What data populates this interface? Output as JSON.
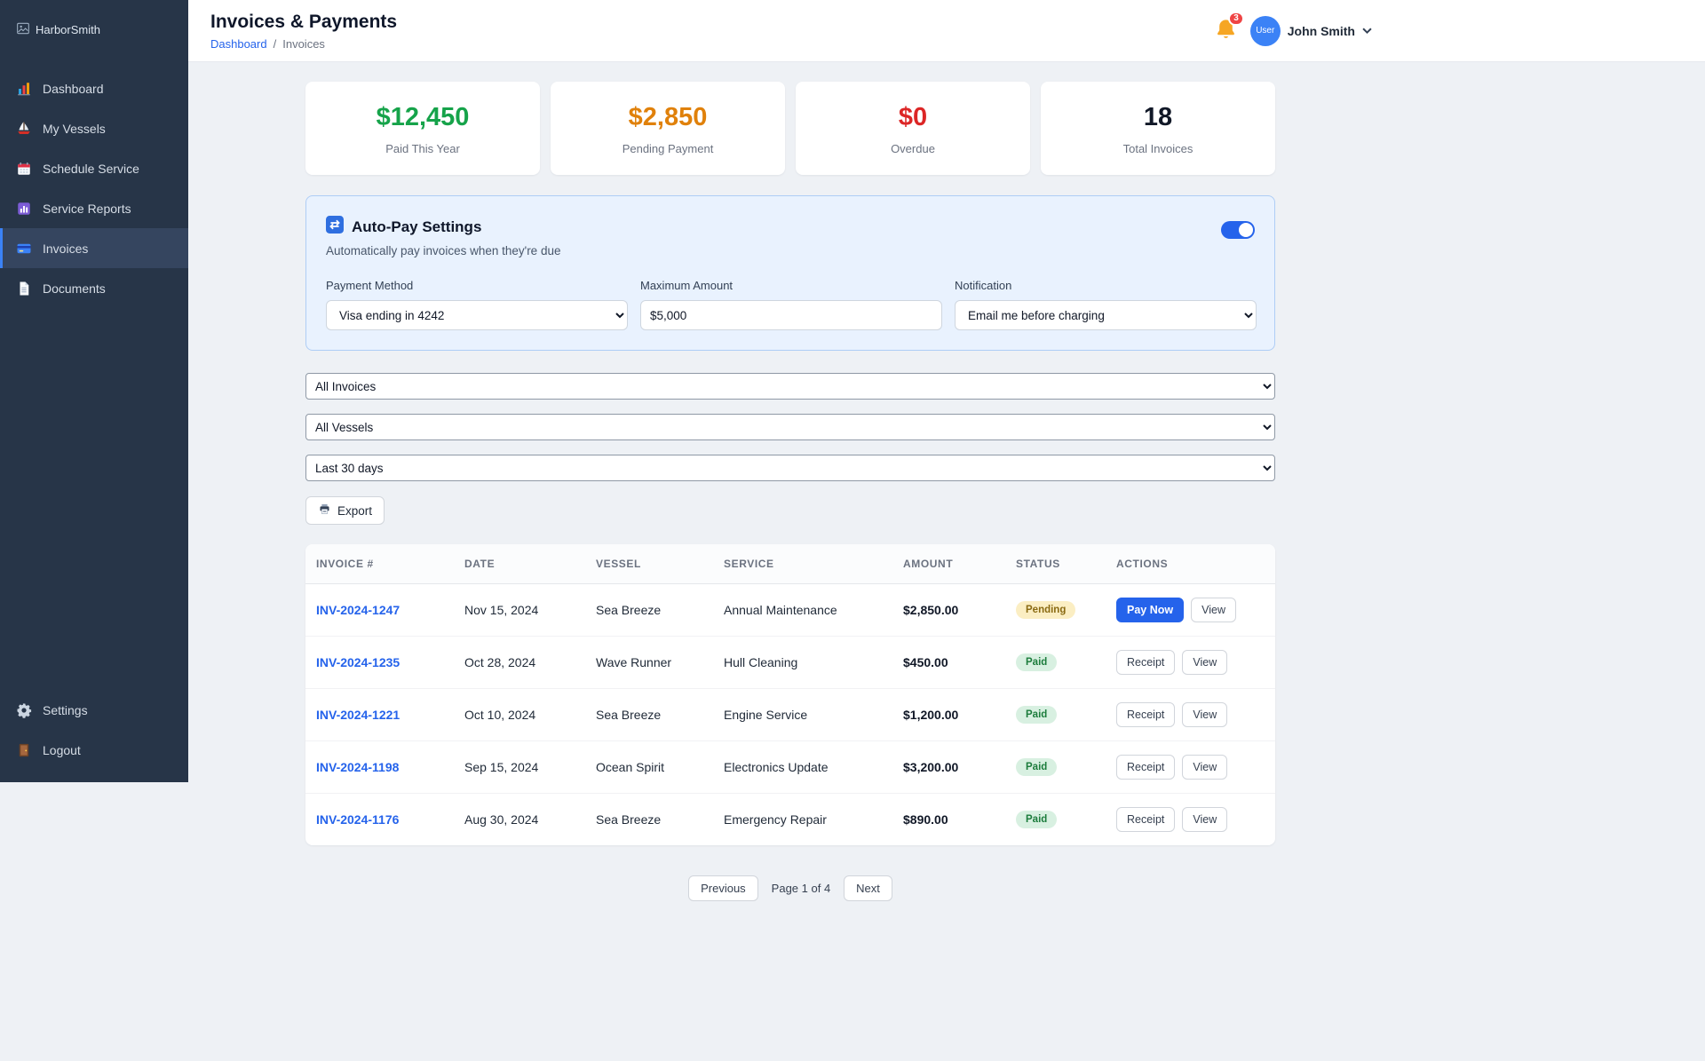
{
  "app": {
    "logo_alt": "HarborSmith"
  },
  "sidebar": {
    "items": [
      {
        "label": "Dashboard",
        "icon": "dashboard-icon"
      },
      {
        "label": "My Vessels",
        "icon": "sailboat-icon"
      },
      {
        "label": "Schedule Service",
        "icon": "calendar-icon"
      },
      {
        "label": "Service Reports",
        "icon": "reports-icon"
      },
      {
        "label": "Invoices",
        "icon": "credit-card-icon",
        "active": true
      },
      {
        "label": "Documents",
        "icon": "document-icon"
      }
    ],
    "footer_items": [
      {
        "label": "Settings",
        "icon": "gear-icon"
      },
      {
        "label": "Logout",
        "icon": "door-icon"
      }
    ]
  },
  "header": {
    "title": "Invoices & Payments",
    "breadcrumb": {
      "parent": "Dashboard",
      "separator": "/",
      "current": "Invoices"
    },
    "notifications_count": "3",
    "avatar_alt": "User",
    "user_name": "John Smith"
  },
  "stats": [
    {
      "value": "$12,450",
      "label": "Paid This Year",
      "color": "#16a34a"
    },
    {
      "value": "$2,850",
      "label": "Pending Payment",
      "color": "#e0810b"
    },
    {
      "value": "$0",
      "label": "Overdue",
      "color": "#dc2626"
    },
    {
      "value": "18",
      "label": "Total Invoices",
      "color": "#111827"
    }
  ],
  "autopay": {
    "title": "Auto-Pay Settings",
    "subtitle": "Automatically pay invoices when they're due",
    "enabled": true,
    "fields": {
      "payment_method": {
        "label": "Payment Method",
        "value": "Visa ending in 4242"
      },
      "maximum_amount": {
        "label": "Maximum Amount",
        "value": "$5,000"
      },
      "notification": {
        "label": "Notification",
        "value": "Email me before charging"
      }
    }
  },
  "filters": {
    "invoice_filter": "All Invoices",
    "vessel_filter": "All Vessels",
    "date_filter": "Last 30 days",
    "export_label": "Export"
  },
  "table": {
    "columns": [
      "INVOICE #",
      "DATE",
      "VESSEL",
      "SERVICE",
      "AMOUNT",
      "STATUS",
      "ACTIONS"
    ],
    "rows": [
      {
        "invoice": "INV-2024-1247",
        "date": "Nov 15, 2024",
        "vessel": "Sea Breeze",
        "service": "Annual Maintenance",
        "amount": "$2,850.00",
        "status": "Pending",
        "actions": [
          "Pay Now",
          "View"
        ]
      },
      {
        "invoice": "INV-2024-1235",
        "date": "Oct 28, 2024",
        "vessel": "Wave Runner",
        "service": "Hull Cleaning",
        "amount": "$450.00",
        "status": "Paid",
        "actions": [
          "Receipt",
          "View"
        ]
      },
      {
        "invoice": "INV-2024-1221",
        "date": "Oct 10, 2024",
        "vessel": "Sea Breeze",
        "service": "Engine Service",
        "amount": "$1,200.00",
        "status": "Paid",
        "actions": [
          "Receipt",
          "View"
        ]
      },
      {
        "invoice": "INV-2024-1198",
        "date": "Sep 15, 2024",
        "vessel": "Ocean Spirit",
        "service": "Electronics Update",
        "amount": "$3,200.00",
        "status": "Paid",
        "actions": [
          "Receipt",
          "View"
        ]
      },
      {
        "invoice": "INV-2024-1176",
        "date": "Aug 30, 2024",
        "vessel": "Sea Breeze",
        "service": "Emergency Repair",
        "amount": "$890.00",
        "status": "Paid",
        "actions": [
          "Receipt",
          "View"
        ]
      }
    ]
  },
  "pagination": {
    "previous": "Previous",
    "status": "Page 1 of 4",
    "next": "Next"
  },
  "colors": {
    "accent": "#2563eb",
    "paid": "#16a34a",
    "pending": "#e0810b",
    "overdue": "#dc2626",
    "sidebar_bg": "#273548"
  }
}
